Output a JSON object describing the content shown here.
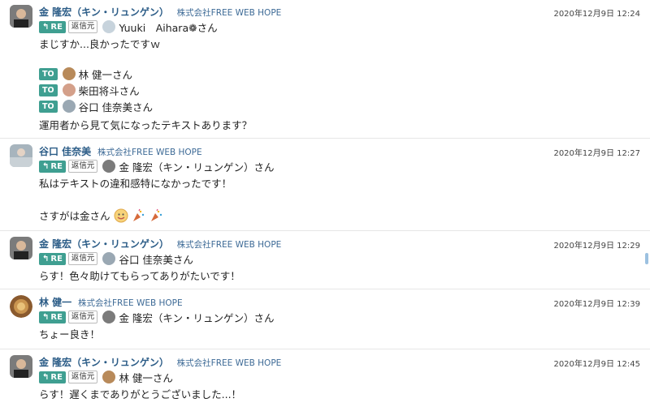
{
  "messages": [
    {
      "name": "金 隆宏（キン・リュンゲン）",
      "org": "株式会社FREE WEB HOPE",
      "time": "2020年12月9日 12:24",
      "re_label": "RE",
      "ref_label": "返信元",
      "reply_to": "Yuuki　Aihara❁さん",
      "lines": [
        "まじすか...良かったですｗ"
      ],
      "to_label": "TO",
      "to": [
        "林 健一さん",
        "柴田将斗さん",
        "谷口 佳奈美さん"
      ],
      "closing": "運用者から見て気になったテキストあります？"
    },
    {
      "name": "谷口 佳奈美",
      "org": "株式会社FREE WEB HOPE",
      "time": "2020年12月9日 12:27",
      "re_label": "RE",
      "ref_label": "返信元",
      "reply_to": "金 隆宏（キン・リュンゲン）さん",
      "lines": [
        "私はテキストの違和感特になかったです！",
        "さすがは金さん"
      ]
    },
    {
      "name": "金 隆宏（キン・リュンゲン）",
      "org": "株式会社FREE WEB HOPE",
      "time": "2020年12月9日 12:29",
      "re_label": "RE",
      "ref_label": "返信元",
      "reply_to": "谷口 佳奈美さん",
      "lines": [
        "らす！色々助けてもらってありがたいです！"
      ]
    },
    {
      "name": "林 健一",
      "org": "株式会社FREE WEB HOPE",
      "time": "2020年12月9日 12:39",
      "re_label": "RE",
      "ref_label": "返信元",
      "reply_to": "金 隆宏（キン・リュンゲン）さん",
      "lines": [
        "ちょー良き！"
      ]
    },
    {
      "name": "金 隆宏（キン・リュンゲン）",
      "org": "株式会社FREE WEB HOPE",
      "time": "2020年12月9日 12:45",
      "re_label": "RE",
      "ref_label": "返信元",
      "reply_to": "林 健一さん",
      "lines": [
        "らす！遅くまでありがとうございました...！"
      ]
    }
  ],
  "icons": {
    "reply": "reply-arrow-icon",
    "emoji_face": "smiling-face-icon",
    "emoji_party": "party-popper-icon"
  },
  "colors": {
    "accent": "#3f9f91",
    "name": "#2b5c87",
    "org": "#3d6a96"
  }
}
